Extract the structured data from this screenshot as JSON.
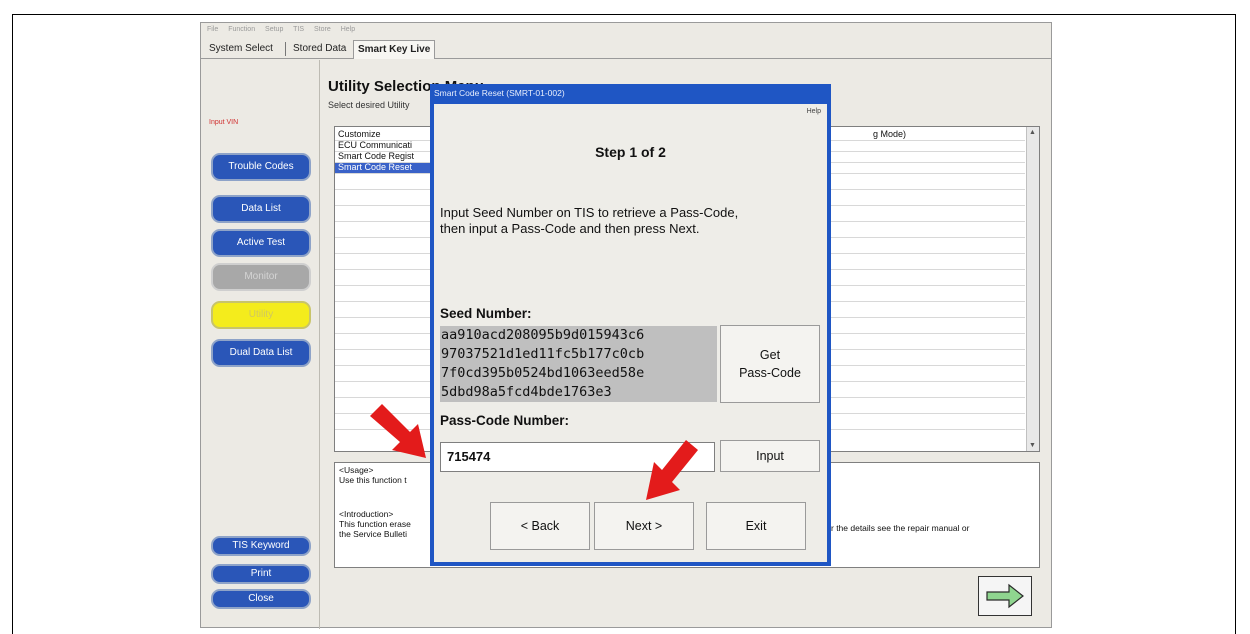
{
  "menubar": [
    "File",
    "Function",
    "Setup",
    "TIS",
    "Store",
    "Help"
  ],
  "tabs": [
    {
      "label": "System Select"
    },
    {
      "label": "Stored Data"
    },
    {
      "label": "Smart Key Live"
    }
  ],
  "sidebar": {
    "input_vin": "Input VIN",
    "buttons": [
      {
        "label": "Trouble Codes"
      },
      {
        "label": "Data List"
      },
      {
        "label": "Active Test"
      },
      {
        "label": "Monitor"
      },
      {
        "label": "Utility"
      },
      {
        "label": "Dual Data List"
      }
    ],
    "bottom_buttons": [
      {
        "label": "TIS Keyword"
      },
      {
        "label": "Print"
      },
      {
        "label": "Close"
      }
    ]
  },
  "utility": {
    "title": "Utility Selection Menu",
    "subtitle": "Select desired Utility",
    "list_items": [
      "Customize",
      "ECU Communicati",
      "Smart Code Regist",
      "Smart Code Reset"
    ],
    "list_right_text": "g Mode)"
  },
  "usage": {
    "usage_heading": "<Usage>",
    "usage_text": "Use this function t",
    "intro_heading": "<Introduction>",
    "intro_text_1": "This function erase",
    "intro_text_2": "the Service Bulleti",
    "intro_right": "r the details see the repair manual or"
  },
  "dialog": {
    "title": "Smart Code Reset (SMRT-01-002)",
    "help": "Help",
    "step": "Step 1 of 2",
    "instruction_1": "Input Seed Number on TIS to retrieve a Pass-Code,",
    "instruction_2": "then input a Pass-Code and then press Next.",
    "seed_label": "Seed Number:",
    "seed_lines": [
      "aa910acd208095b9d015943c6",
      "97037521d1ed11fc5b177c0cb",
      "7f0cd395b0524bd1063eed58e",
      "5dbd98a5fcd4bde1763e3"
    ],
    "get_passcode_1": "Get",
    "get_passcode_2": "Pass-Code",
    "passcode_label": "Pass-Code Number:",
    "passcode_value": "715474",
    "input_button": "Input",
    "back_button": "< Back",
    "next_button": "Next >",
    "exit_button": "Exit"
  },
  "colors": {
    "dialog_blue": "#1f56c4",
    "sidebar_blue": "#2a56b8",
    "arrow_red": "#e31b1b",
    "selection_blue": "#3a62c8"
  }
}
